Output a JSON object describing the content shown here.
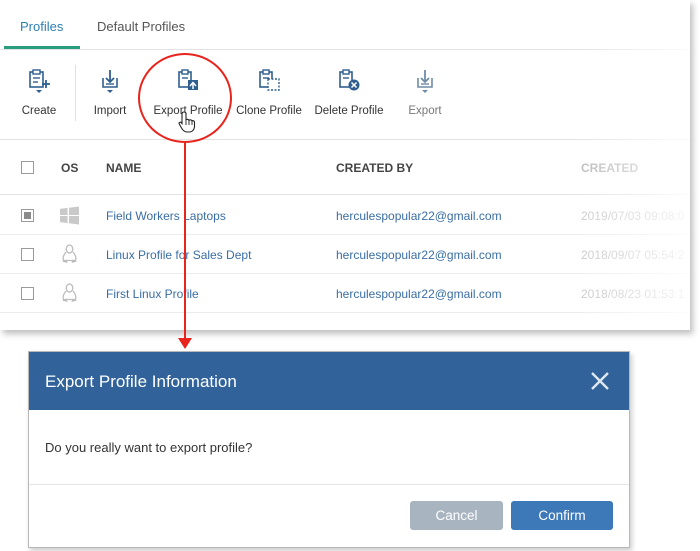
{
  "tabs": [
    {
      "label": "Profiles",
      "active": true
    },
    {
      "label": "Default Profiles",
      "active": false
    }
  ],
  "toolbar": {
    "create": {
      "label": "Create",
      "icon": "create-profile-icon"
    },
    "import": {
      "label": "Import",
      "icon": "import-icon"
    },
    "export_profile": {
      "label": "Export Profile",
      "icon": "export-profile-icon"
    },
    "clone_profile": {
      "label": "Clone Profile",
      "icon": "clone-profile-icon"
    },
    "delete_profile": {
      "label": "Delete Profile",
      "icon": "delete-profile-icon"
    },
    "export": {
      "label": "Export",
      "icon": "export-icon"
    }
  },
  "table": {
    "columns": [
      "OS",
      "NAME",
      "CREATED BY",
      "CREATED"
    ],
    "rows": [
      {
        "checked": true,
        "os": "windows",
        "name": "Field Workers Laptops",
        "created_by": "herculespopular22@gmail.com",
        "created": "2019/07/03 09:08:0"
      },
      {
        "checked": false,
        "os": "linux",
        "name": "Linux Profile for Sales Dept",
        "created_by": "herculespopular22@gmail.com",
        "created": "2018/09/07 05:54:2"
      },
      {
        "checked": false,
        "os": "linux",
        "name": "First Linux Profile",
        "created_by": "herculespopular22@gmail.com",
        "created": "2018/08/23 01:53:1"
      }
    ]
  },
  "dialog": {
    "title": "Export Profile Information",
    "message": "Do you really want to export profile?",
    "cancel_label": "Cancel",
    "confirm_label": "Confirm"
  },
  "colors": {
    "accent": "#2a9d80",
    "link": "#3a6ea5",
    "dialog_header": "#31639a",
    "highlight": "#e8241c",
    "confirm": "#3d79b8",
    "cancel": "#a8b5c1"
  }
}
